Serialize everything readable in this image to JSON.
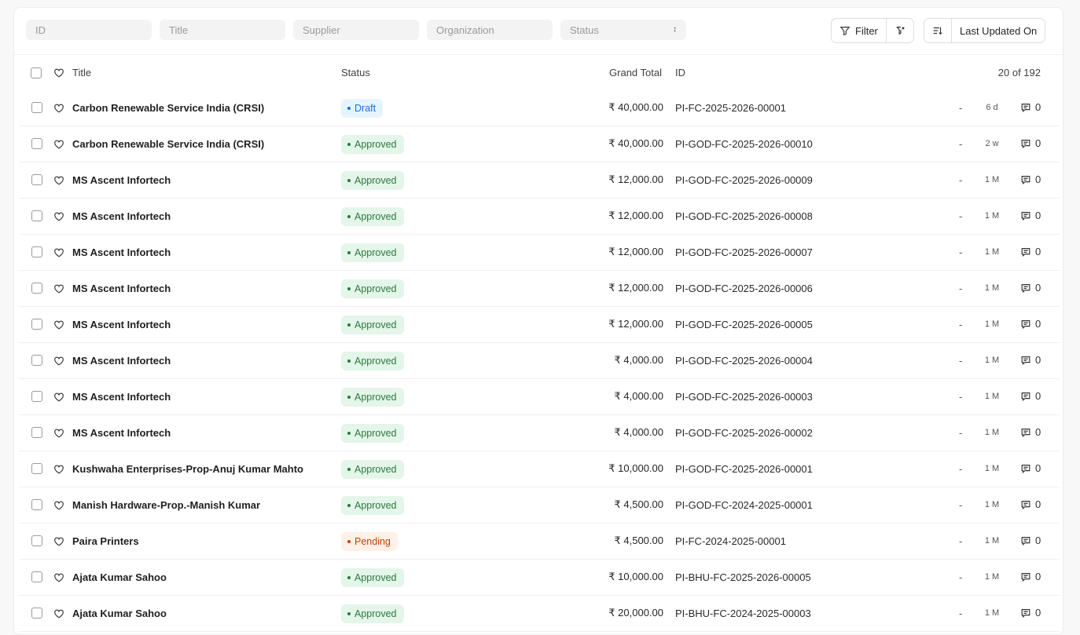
{
  "filters": {
    "id_placeholder": "ID",
    "title_placeholder": "Title",
    "supplier_placeholder": "Supplier",
    "organization_placeholder": "Organization",
    "status_placeholder": "Status"
  },
  "toolbar": {
    "filter_label": "Filter",
    "sort_label": "Last Updated On"
  },
  "columns": {
    "title": "Title",
    "status": "Status",
    "grand_total": "Grand Total",
    "id": "ID",
    "count": "20 of 192"
  },
  "status_colors": {
    "Draft": {
      "bg": "#e6f4ff",
      "fg": "#1e6fd9"
    },
    "Approved": {
      "bg": "#e4f5e9",
      "fg": "#2b7a3e"
    },
    "Pending": {
      "bg": "#fff1e7",
      "fg": "#c2410c"
    }
  },
  "rows": [
    {
      "title": "Carbon Renewable Service India (CRSI)",
      "status": "Draft",
      "amount": "₹ 40,000.00",
      "id": "PI-FC-2025-2026-00001",
      "dash": "-",
      "ago": "6 d",
      "comments": "0"
    },
    {
      "title": "Carbon Renewable Service India (CRSI)",
      "status": "Approved",
      "amount": "₹ 40,000.00",
      "id": "PI-GOD-FC-2025-2026-00010",
      "dash": "-",
      "ago": "2 w",
      "comments": "0"
    },
    {
      "title": "MS Ascent Infortech",
      "status": "Approved",
      "amount": "₹ 12,000.00",
      "id": "PI-GOD-FC-2025-2026-00009",
      "dash": "-",
      "ago": "1 M",
      "comments": "0"
    },
    {
      "title": "MS Ascent Infortech",
      "status": "Approved",
      "amount": "₹ 12,000.00",
      "id": "PI-GOD-FC-2025-2026-00008",
      "dash": "-",
      "ago": "1 M",
      "comments": "0"
    },
    {
      "title": "MS Ascent Infortech",
      "status": "Approved",
      "amount": "₹ 12,000.00",
      "id": "PI-GOD-FC-2025-2026-00007",
      "dash": "-",
      "ago": "1 M",
      "comments": "0"
    },
    {
      "title": "MS Ascent Infortech",
      "status": "Approved",
      "amount": "₹ 12,000.00",
      "id": "PI-GOD-FC-2025-2026-00006",
      "dash": "-",
      "ago": "1 M",
      "comments": "0"
    },
    {
      "title": "MS Ascent Infortech",
      "status": "Approved",
      "amount": "₹ 12,000.00",
      "id": "PI-GOD-FC-2025-2026-00005",
      "dash": "-",
      "ago": "1 M",
      "comments": "0"
    },
    {
      "title": "MS Ascent Infortech",
      "status": "Approved",
      "amount": "₹ 4,000.00",
      "id": "PI-GOD-FC-2025-2026-00004",
      "dash": "-",
      "ago": "1 M",
      "comments": "0"
    },
    {
      "title": "MS Ascent Infortech",
      "status": "Approved",
      "amount": "₹ 4,000.00",
      "id": "PI-GOD-FC-2025-2026-00003",
      "dash": "-",
      "ago": "1 M",
      "comments": "0"
    },
    {
      "title": "MS Ascent Infortech",
      "status": "Approved",
      "amount": "₹ 4,000.00",
      "id": "PI-GOD-FC-2025-2026-00002",
      "dash": "-",
      "ago": "1 M",
      "comments": "0"
    },
    {
      "title": "Kushwaha Enterprises-Prop-Anuj Kumar Mahto",
      "status": "Approved",
      "amount": "₹ 10,000.00",
      "id": "PI-GOD-FC-2025-2026-00001",
      "dash": "-",
      "ago": "1 M",
      "comments": "0"
    },
    {
      "title": "Manish Hardware-Prop.-Manish Kumar",
      "status": "Approved",
      "amount": "₹ 4,500.00",
      "id": "PI-GOD-FC-2024-2025-00001",
      "dash": "-",
      "ago": "1 M",
      "comments": "0"
    },
    {
      "title": "Paira Printers",
      "status": "Pending",
      "amount": "₹ 4,500.00",
      "id": "PI-FC-2024-2025-00001",
      "dash": "-",
      "ago": "1 M",
      "comments": "0"
    },
    {
      "title": "Ajata Kumar Sahoo",
      "status": "Approved",
      "amount": "₹ 10,000.00",
      "id": "PI-BHU-FC-2025-2026-00005",
      "dash": "-",
      "ago": "1 M",
      "comments": "0"
    },
    {
      "title": "Ajata Kumar Sahoo",
      "status": "Approved",
      "amount": "₹ 20,000.00",
      "id": "PI-BHU-FC-2024-2025-00003",
      "dash": "-",
      "ago": "1 M",
      "comments": "0"
    }
  ]
}
